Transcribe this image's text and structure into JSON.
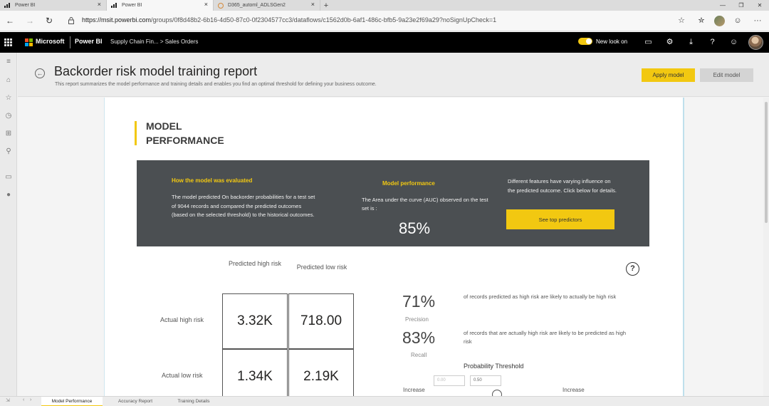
{
  "browser": {
    "tabs": [
      {
        "label": "Power BI",
        "active": false
      },
      {
        "label": "Power BI",
        "active": true
      },
      {
        "label": "D365_automl_ADLSGen2",
        "active": false
      }
    ],
    "new_tab": "+",
    "url_host": "https://msit.powerbi.com",
    "url_path": "/groups/0f8d48b2-6b16-4d50-87c0-0f2304577cc3/dataflows/c1562d0b-6af1-486c-bfb5-9a23e2f69a29?noSignUpCheck=1"
  },
  "pbi_bar": {
    "brand": "Microsoft",
    "product": "Power BI",
    "breadcrumb": "Supply Chain Fin...  >  Sales Orders",
    "new_look_label": "New look on"
  },
  "report": {
    "title": "Backorder risk model training report",
    "subtitle": "This report summarizes the model performance and training details and enables you find an optimal threshold for defining your business outcome.",
    "apply_button": "Apply model",
    "edit_button": "Edit model"
  },
  "section": {
    "title_line1": "MODEL",
    "title_line2": "PERFORMANCE"
  },
  "evaluation": {
    "heading": "How the model was evaluated",
    "text": "The model predicted On backorder probabilities for a test set of 9044 records and compared the predicted outcomes (based on the selected threshold) to the historical outcomes."
  },
  "performance": {
    "heading": "Model performance",
    "text": "The Area under the curve (AUC) observed on the test set is :",
    "auc": "85%"
  },
  "predictors": {
    "text": "Different features have varying influence on the predicted outcome.  Click below for details.",
    "button": "See top predictors"
  },
  "matrix": {
    "col_high": "Predicted high risk",
    "col_low": "Predicted low risk",
    "row_high": "Actual high risk",
    "row_low": "Actual low risk",
    "cells": [
      "3.32K",
      "718.00",
      "1.34K",
      "2.19K"
    ]
  },
  "metrics": {
    "precision_value": "71%",
    "precision_label": "Precision",
    "precision_desc": "of records predicted as high risk are likely to actually be high risk",
    "recall_value": "83%",
    "recall_label": "Recall",
    "recall_desc": "of records that are actually high risk are likely to be predicted as high risk"
  },
  "threshold": {
    "title": "Probability Threshold",
    "min_value": "0.00",
    "value": "0.50",
    "left_label": "Increase",
    "right_label": "Increase"
  },
  "page_tabs": [
    {
      "label": "Model Performance",
      "active": true
    },
    {
      "label": "Accuracy Report",
      "active": false
    },
    {
      "label": "Training Details",
      "active": false
    }
  ],
  "colors": {
    "accent": "#f2c811",
    "dark_panel": "#4b4f52",
    "topbar": "#000000"
  }
}
